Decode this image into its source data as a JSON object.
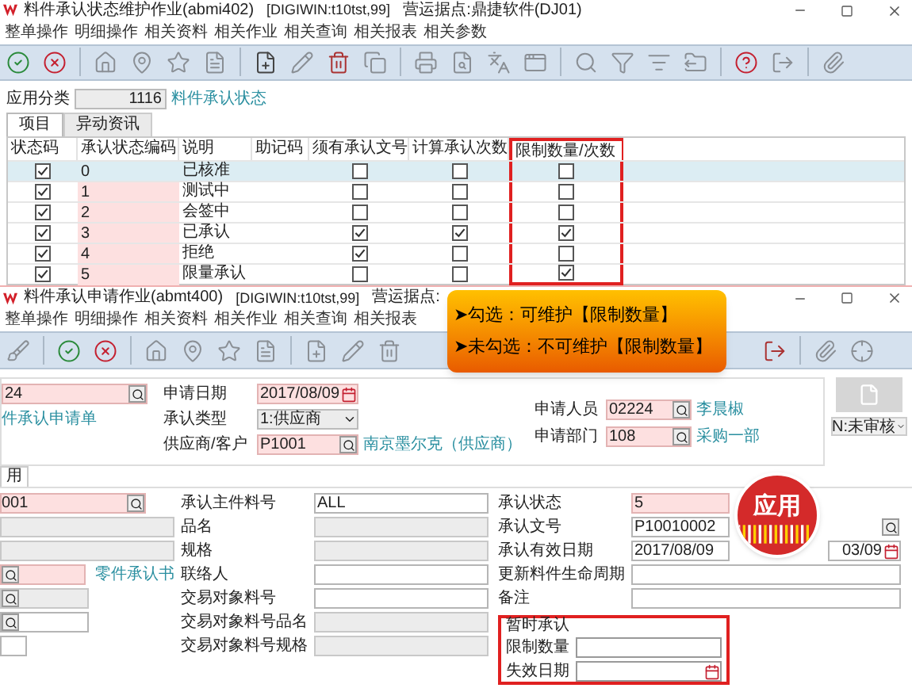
{
  "window1": {
    "title": "料件承认状态维护作业(abmi402)",
    "workspace": "[DIGIWIN:t10tst,99]",
    "site": "营运据点:鼎捷软件(DJ01)",
    "menu": [
      "整单操作",
      "明细操作",
      "相关资料",
      "相关作业",
      "相关查询",
      "相关报表",
      "相关参数"
    ],
    "filter": {
      "label": "应用分类",
      "value": "1116",
      "link": "料件承认状态"
    },
    "tabs": [
      {
        "label": "项目",
        "selected": true
      },
      {
        "label": "异动资讯",
        "selected": false
      }
    ],
    "table": {
      "columns": [
        "状态码",
        "承认状态编码",
        "说明",
        "助记码",
        "须有承认文号",
        "计算承认次数",
        "限制数量/次数"
      ],
      "rows": [
        {
          "status": true,
          "code": "0",
          "description": "已核准",
          "requires_doc_no": false,
          "count_approvals": false,
          "limit_quantity": false,
          "selected": true
        },
        {
          "status": true,
          "code": "1",
          "description": "测试中",
          "requires_doc_no": false,
          "count_approvals": false,
          "limit_quantity": false,
          "selected": false
        },
        {
          "status": true,
          "code": "2",
          "description": "会签中",
          "requires_doc_no": false,
          "count_approvals": false,
          "limit_quantity": false,
          "selected": false
        },
        {
          "status": true,
          "code": "3",
          "description": "已承认",
          "requires_doc_no": true,
          "count_approvals": true,
          "limit_quantity": true,
          "selected": false
        },
        {
          "status": true,
          "code": "4",
          "description": "拒绝",
          "requires_doc_no": true,
          "count_approvals": false,
          "limit_quantity": false,
          "selected": false
        },
        {
          "status": true,
          "code": "5",
          "description": "限量承认",
          "requires_doc_no": false,
          "count_approvals": false,
          "limit_quantity": true,
          "selected": false
        }
      ]
    }
  },
  "window2": {
    "title": "料件承认申请作业(abmt400)",
    "workspace": "[DIGIWIN:t10tst,99]",
    "site": "营运据点:",
    "menu": [
      "整单操作",
      "明细操作",
      "相关资料",
      "相关作业",
      "相关查询",
      "相关报表"
    ],
    "doc_no": {
      "value": "24",
      "link": "件承认申请单"
    },
    "middle": [
      {
        "label": "申请日期",
        "value": "2017/08/09",
        "kind": "date"
      },
      {
        "label": "承认类型",
        "value": "1:供应商",
        "kind": "select"
      },
      {
        "label": "供应商/客户",
        "value": "P1001",
        "kind": "lookup",
        "link": "南京墨尔克（供应商）"
      }
    ],
    "right": [
      {
        "label": "申请人员",
        "value": "02224",
        "link": "李晨椒"
      },
      {
        "label": "申请部门",
        "value": "108",
        "link": "采购一部"
      }
    ],
    "status": "N:未审核",
    "tab": "用",
    "detail_left": [
      {
        "kind": "required",
        "value": "001",
        "lookup": true
      },
      {
        "kind": "readonly",
        "lookup": false
      },
      {
        "kind": "readonly",
        "lookup": false
      },
      {
        "kind": "required",
        "lookup": true,
        "link": "零件承认书"
      },
      {
        "kind": "readonly",
        "lookup": true
      },
      {
        "kind": "input",
        "lookup": true
      },
      {
        "kind": "input",
        "lookup": false
      }
    ],
    "detail_middle": [
      {
        "label": "承认主件料号",
        "value": "ALL",
        "kind": "input"
      },
      {
        "label": "品名",
        "kind": "readonly"
      },
      {
        "label": "规格",
        "kind": "readonly"
      },
      {
        "label": "联络人",
        "kind": "input"
      },
      {
        "label": "交易对象料号",
        "kind": "input"
      },
      {
        "label": "交易对象料号品名",
        "kind": "readonly"
      },
      {
        "label": "交易对象料号规格",
        "kind": "readonly"
      }
    ],
    "detail_right": [
      {
        "label": "承认状态",
        "value": "5",
        "kind": "required"
      },
      {
        "label": "承认文号",
        "value": "P10010002",
        "kind": "input"
      },
      {
        "label": "承认有效日期",
        "value": "2017/08/09",
        "kind": "input",
        "value_2": "03/09"
      },
      {
        "label": "更新料件生命周期",
        "kind": "input"
      },
      {
        "label": "备注",
        "kind": "input"
      }
    ],
    "temp_group": {
      "title": "暂时承认",
      "fields": [
        {
          "label": "限制数量",
          "kind": "input"
        },
        {
          "label": "失效日期",
          "kind": "date"
        }
      ]
    }
  },
  "callout": {
    "lines": [
      "➤勾选：可维护【限制数量】",
      "➤未勾选：不可维护【限制数量】"
    ]
  },
  "badge": "应用"
}
